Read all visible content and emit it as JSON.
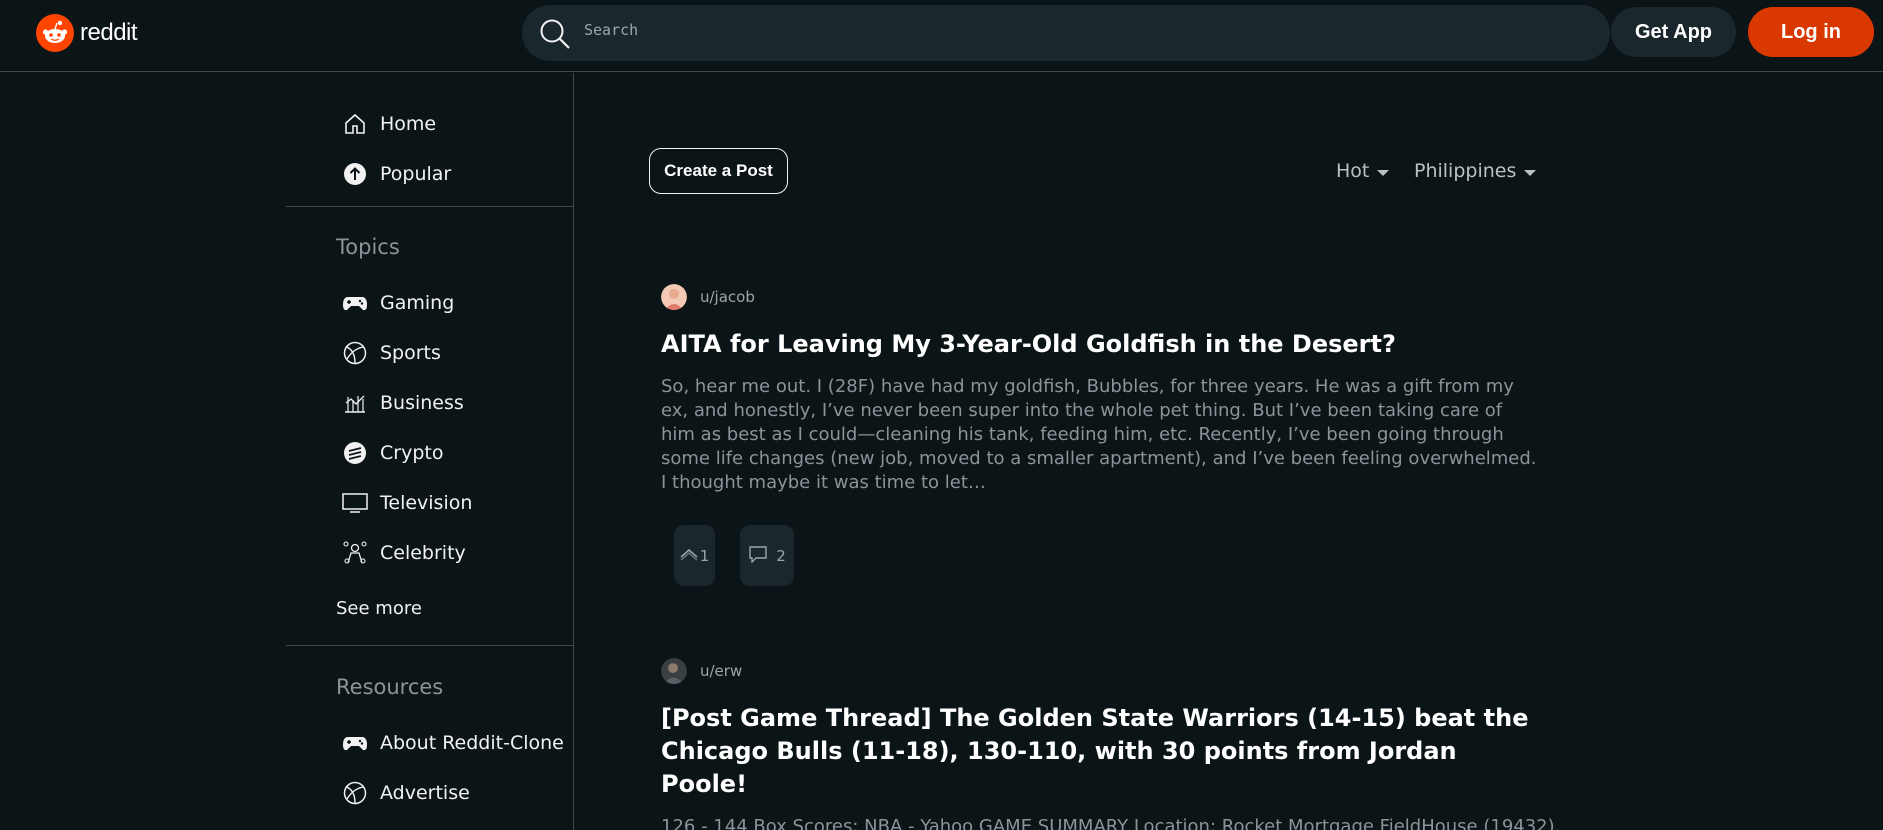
{
  "header": {
    "logo_text": "reddit",
    "search_placeholder": "Search",
    "get_app_label": "Get App",
    "login_label": "Log in"
  },
  "sidebar": {
    "main_items": [
      {
        "label": "Home",
        "icon": "home-icon"
      },
      {
        "label": "Popular",
        "icon": "popular-icon"
      }
    ],
    "topics_heading": "Topics",
    "topics": [
      {
        "label": "Gaming",
        "icon": "gamepad-icon"
      },
      {
        "label": "Sports",
        "icon": "ball-icon"
      },
      {
        "label": "Business",
        "icon": "chart-icon"
      },
      {
        "label": "Crypto",
        "icon": "crypto-icon"
      },
      {
        "label": "Television",
        "icon": "tv-icon"
      },
      {
        "label": "Celebrity",
        "icon": "celebrity-icon"
      }
    ],
    "see_more_label": "See more",
    "resources_heading": "Resources",
    "resources": [
      {
        "label": "About Reddit-Clone",
        "icon": "gamepad-icon"
      },
      {
        "label": "Advertise",
        "icon": "ball-icon"
      }
    ]
  },
  "main": {
    "create_post_label": "Create a Post",
    "sort_label": "Hot",
    "region_label": "Philippines",
    "posts": [
      {
        "author": "u/jacob",
        "title": "AITA for Leaving My 3-Year-Old Goldfish in the Desert?",
        "body": "So, hear me out. I (28F) have had my goldfish, Bubbles, for three years. He was a gift from my ex, and honestly, I’ve never been super into the whole pet thing. But I’ve been taking care of him as best as I could—cleaning his tank, feeding him, etc. Recently, I’ve been going through some life changes (new job, moved to a smaller apartment), and I’ve been feeling overwhelmed. I thought maybe it was time to let…",
        "upvotes": "1",
        "comments": "2"
      },
      {
        "author": "u/erw",
        "title": "[Post Game Thread] The Golden State Warriors (14-15) beat the Chicago Bulls (11-18), 130-110, with 30 points from Jordan Poole!",
        "body": "126 - 144 Box Scores: NBA - Yahoo GAME SUMMARY Location: Rocket Mortgage FieldHouse (19432),"
      }
    ]
  },
  "colors": {
    "background": "#0b1416",
    "accent": "#d93900",
    "brand": "#ff4500",
    "surface": "#1a282d"
  }
}
